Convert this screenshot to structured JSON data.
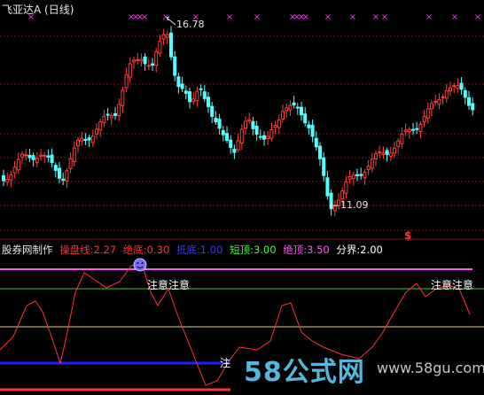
{
  "window": {
    "title": "飞亚达A (日线)"
  },
  "price_chart": {
    "high_label": "16.78",
    "low_label": "11.09",
    "marker_char": "×",
    "colors": {
      "up": "#ff3b3b",
      "down": "#54ffff",
      "grid": "#7a1414",
      "marker": "#ff33ff"
    }
  },
  "indicator": {
    "name": "股券网制作",
    "params": [
      {
        "label": "操盘线:2.27",
        "color": "#ff3333"
      },
      {
        "label": "绝底:0.30",
        "color": "#ff3333"
      },
      {
        "label": "抵底:1.00",
        "color": "#3a3aff"
      },
      {
        "label": "短顶:3.00",
        "color": "#33ff33"
      },
      {
        "label": "绝顶:3.50",
        "color": "#ff55ff"
      },
      {
        "label": "分界:2.00",
        "color": "#ffffff"
      }
    ],
    "notes": [
      "注意注意",
      "注意注意",
      "注"
    ],
    "dollar_sign": "$",
    "colors": {
      "line": "#ff3333",
      "top": "#ff55ff",
      "short_top": "#33cc33",
      "divider": "#e6c8a0",
      "low": "#2020ff",
      "bottom": "#ff3333"
    }
  },
  "watermark": {
    "text": "58公式网",
    "url": "www.58gu.com"
  }
}
